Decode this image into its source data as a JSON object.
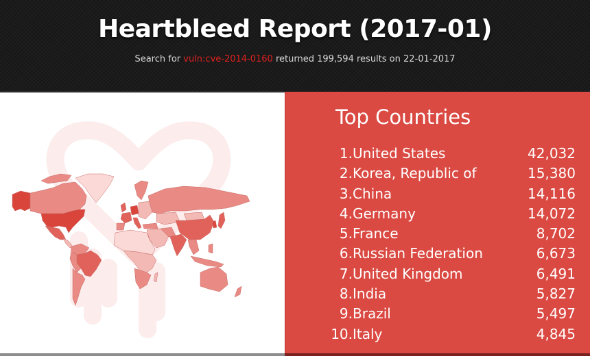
{
  "header": {
    "title": "Heartbleed Report (2017-01)",
    "subtitle_prefix": "Search for ",
    "query": "vuln:cve-2014-0160",
    "subtitle_suffix": " returned 199,594 results on 22-01-2017"
  },
  "map": {
    "background_icon": "heartbleed-bleeding-heart-icon",
    "colors": {
      "highest": "#d9443b",
      "high": "#e0625a",
      "medium": "#e98a84",
      "low": "#f3b9b5",
      "lowest": "#fbd9d7",
      "heart_watermark": "#fcecec"
    }
  },
  "top_countries": {
    "title": "Top Countries",
    "items": [
      {
        "rank": "1.",
        "country": "United States",
        "count": "42,032"
      },
      {
        "rank": "2.",
        "country": "Korea, Republic of",
        "count": "15,380"
      },
      {
        "rank": "3.",
        "country": "China",
        "count": "14,116"
      },
      {
        "rank": "4.",
        "country": "Germany",
        "count": "14,072"
      },
      {
        "rank": "5.",
        "country": "France",
        "count": "8,702"
      },
      {
        "rank": "6.",
        "country": "Russian Federation",
        "count": "6,673"
      },
      {
        "rank": "7.",
        "country": "United Kingdom",
        "count": "6,491"
      },
      {
        "rank": "8.",
        "country": "India",
        "count": "5,827"
      },
      {
        "rank": "9.",
        "country": "Brazil",
        "count": "5,497"
      },
      {
        "rank": "10.",
        "country": "Italy",
        "count": "4,845"
      }
    ]
  },
  "colors": {
    "header_bg": "#1b1b1b",
    "query_highlight": "#e0211f",
    "panel_red": "#da4a43"
  }
}
